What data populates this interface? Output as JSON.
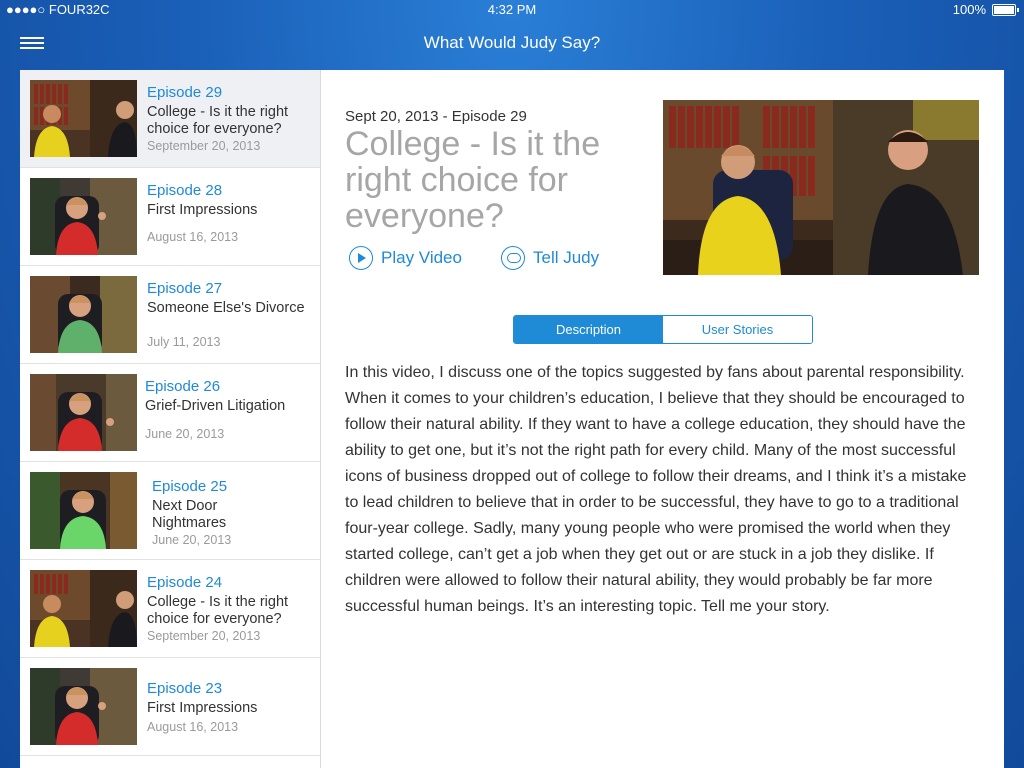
{
  "status": {
    "carrier": "●●●●○ FOUR32C",
    "time": "4:32 PM",
    "battery": "100%"
  },
  "navbar": {
    "title": "What Would Judy Say?"
  },
  "episodes": [
    {
      "episode": "Episode 29",
      "title": "College - Is it the right choice for everyone?",
      "date": "September 20, 2013"
    },
    {
      "episode": "Episode 28",
      "title": "First Impressions",
      "date": "August 16, 2013"
    },
    {
      "episode": "Episode 27",
      "title": "Someone Else's Divorce",
      "date": "July 11, 2013"
    },
    {
      "episode": "Episode 26",
      "title": "Grief-Driven Litigation",
      "date": "June 20, 2013"
    },
    {
      "episode": "Episode 25",
      "title": "Next Door Nightmares",
      "date": "June 20, 2013"
    },
    {
      "episode": "Episode 24",
      "title": "College - Is it the right choice for everyone?",
      "date": "September 20, 2013"
    },
    {
      "episode": "Episode 23",
      "title": "First Impressions",
      "date": "August 16, 2013"
    }
  ],
  "detail": {
    "subhead": "Sept 20, 2013 - Episode 29",
    "title": "College - Is it the right choice for everyone?",
    "play_label": "Play Video",
    "tell_label": "Tell Judy",
    "tabs": [
      "Description",
      "User Stories"
    ],
    "description": "In this video, I discuss one of the topics suggested by fans about parental responsibility. When it comes to your children’s education, I believe that they should be encouraged to follow their natural ability. If they want to have a college education, they should have the ability to get one, but it’s not the right path for every child. Many of the most successful icons of business dropped out of college to follow their dreams, and I think it’s a mistake to lead children to believe that in order to be successful, they have to go to a traditional four-year college. Sadly, many young people who were promised the world when they started college, can’t get a job when they get out or are stuck in a job they dislike. If children were allowed to follow their natural ability, they would probably be far more successful human beings. It’s an interesting topic. Tell me your story."
  },
  "colors": {
    "accent": "#1f8ad6",
    "background_blue": "#1a5fb8"
  }
}
